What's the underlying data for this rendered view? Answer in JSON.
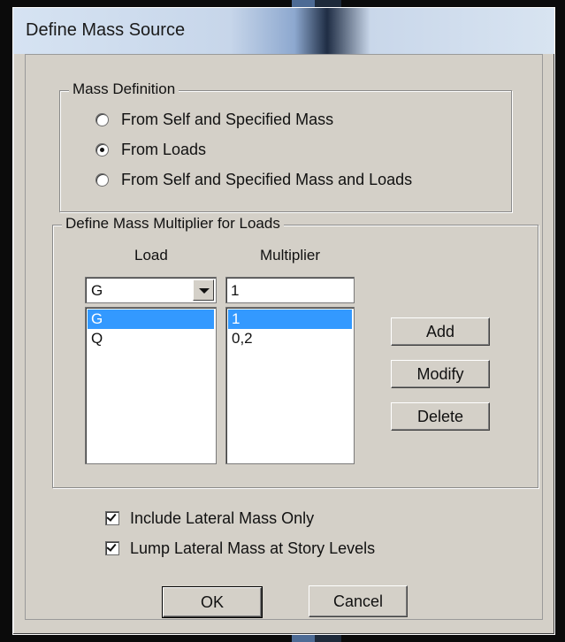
{
  "window": {
    "title": "Define Mass Source"
  },
  "mass_definition": {
    "label": "Mass Definition",
    "options": [
      {
        "label": "From Self and Specified Mass",
        "checked": false
      },
      {
        "label": "From Loads",
        "checked": true
      },
      {
        "label": "From Self and Specified Mass and Loads",
        "checked": false
      }
    ]
  },
  "multiplier": {
    "label": "Define Mass Multiplier for Loads",
    "load_header": "Load",
    "multiplier_header": "Multiplier",
    "load_combo_value": "G",
    "multiplier_input_value": "1",
    "load_list": [
      "G",
      "Q"
    ],
    "multiplier_list": [
      "1",
      "0,2"
    ],
    "add_label": "Add",
    "modify_label": "Modify",
    "delete_label": "Delete"
  },
  "options": {
    "include_lateral": {
      "label": "Include Lateral Mass Only",
      "checked": true
    },
    "lump_lateral": {
      "label": "Lump Lateral Mass at Story Levels",
      "checked": true
    }
  },
  "footer": {
    "ok_label": "OK",
    "cancel_label": "Cancel"
  }
}
